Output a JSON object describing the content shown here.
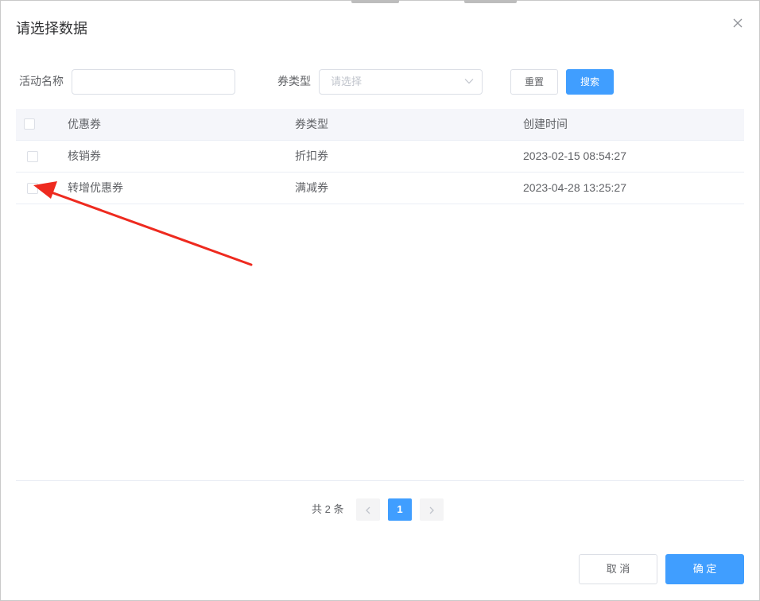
{
  "dialog": {
    "title": "请选择数据",
    "close_icon": "close-icon"
  },
  "filters": {
    "activity_label": "活动名称",
    "activity_value": "",
    "type_label": "券类型",
    "type_placeholder": "请选择",
    "reset_label": "重置",
    "search_label": "搜索"
  },
  "table": {
    "columns": [
      "优惠券",
      "券类型",
      "创建时间"
    ],
    "rows": [
      {
        "name": "核销券",
        "type": "折扣券",
        "created": "2023-02-15 08:54:27"
      },
      {
        "name": "转增优惠券",
        "type": "满减券",
        "created": "2023-04-28 13:25:27"
      }
    ]
  },
  "pagination": {
    "total_text": "共 2 条",
    "current_page": "1",
    "prev_icon": "chevron-left-icon",
    "next_icon": "chevron-right-icon"
  },
  "footer": {
    "cancel_label": "取 消",
    "confirm_label": "确 定"
  },
  "colors": {
    "primary": "#409eff",
    "annotation_arrow": "#ee2a1f"
  }
}
